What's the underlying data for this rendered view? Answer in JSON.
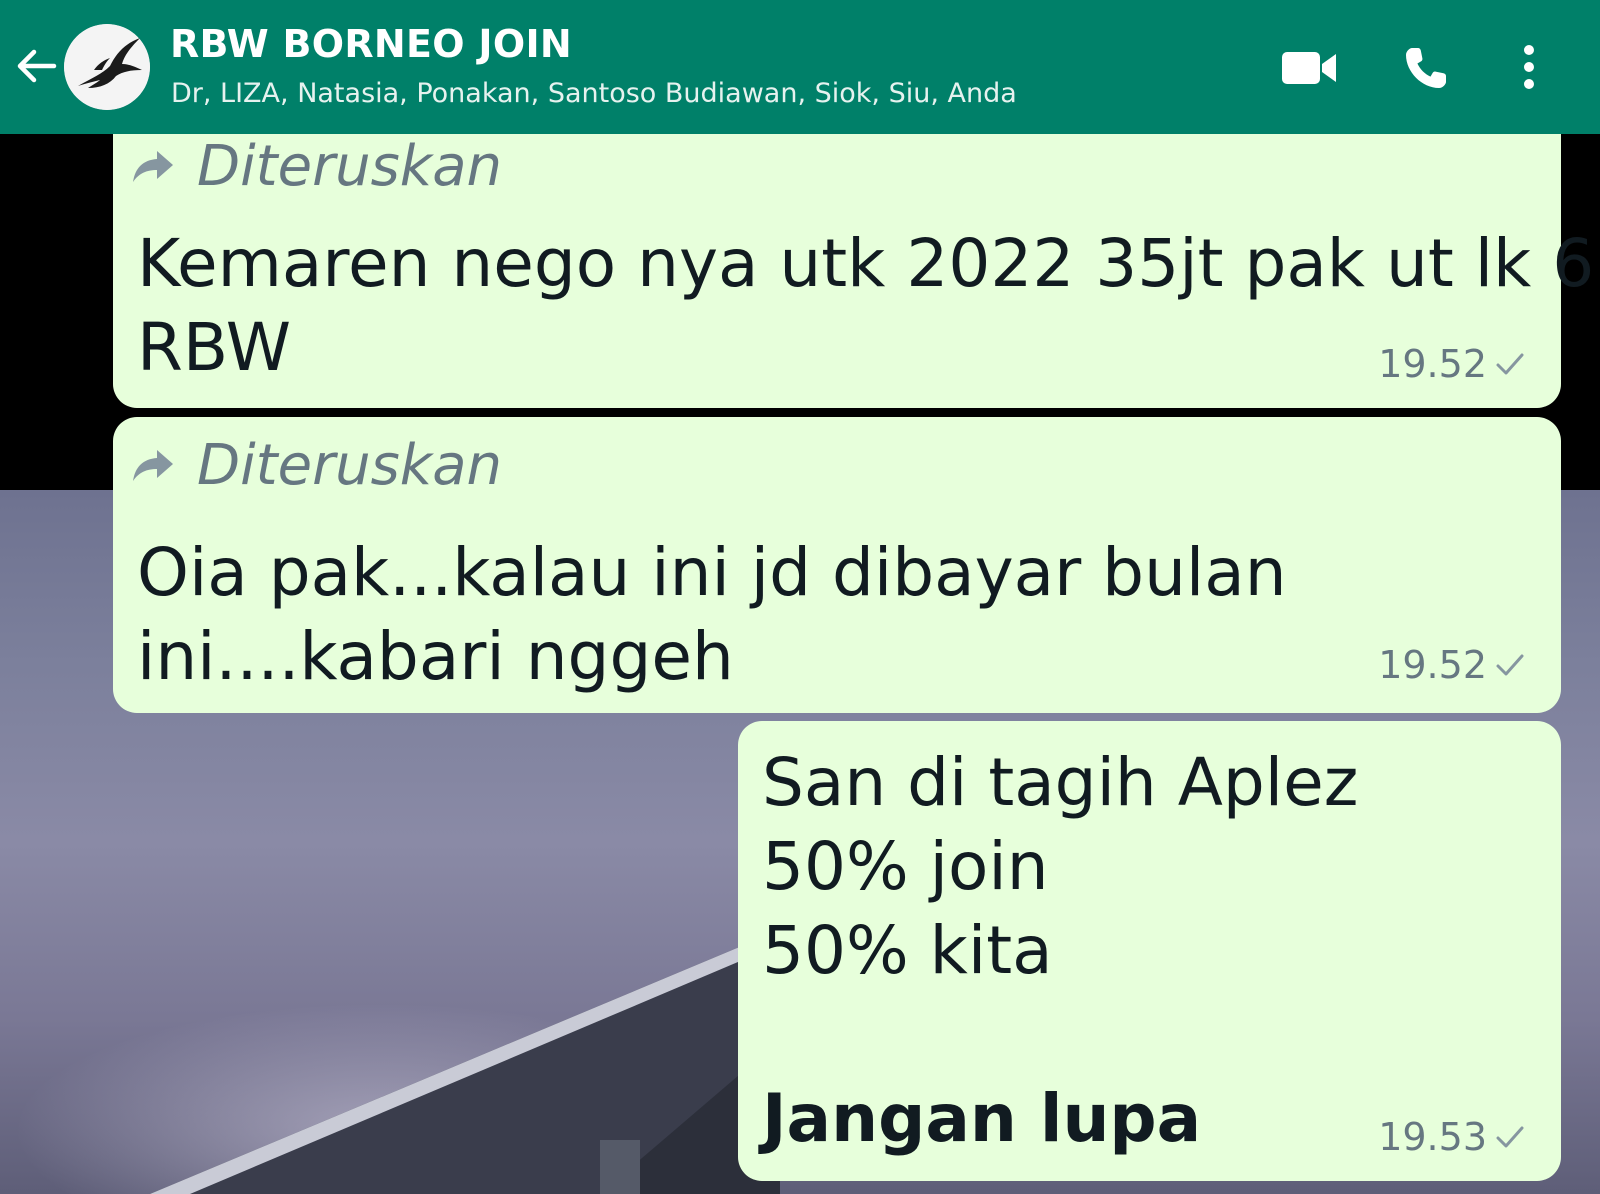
{
  "header": {
    "title": "RBW BORNEO JOIN",
    "members": "Dr, LIZA, Natasia, Ponakan, Santoso Budiawan, Siok, Siu, Anda",
    "color": "#008069",
    "icons": [
      "back-arrow-icon",
      "video-call-icon",
      "voice-call-icon",
      "more-options-icon"
    ]
  },
  "messages": [
    {
      "forwarded_label": "Diteruskan",
      "lines": [
        "Kemaren nego nya utk 2022 35jt pak ut lk 6",
        "RBW"
      ],
      "time": "19.52",
      "status": "sent"
    },
    {
      "forwarded_label": "Diteruskan",
      "lines": [
        "Oia pak...kalau ini jd dibayar bulan",
        "ini....kabari nggeh"
      ],
      "time": "19.52",
      "status": "sent"
    },
    {
      "lines": [
        "San di tagih Aplez",
        "50% join",
        "50% kita",
        ""
      ],
      "bold_line": "Jangan lupa",
      "time": "19.53",
      "status": "sent"
    }
  ],
  "colors": {
    "outgoing_bubble": "#e7ffdb",
    "meta_text": "#667781",
    "message_text": "#111b21"
  }
}
